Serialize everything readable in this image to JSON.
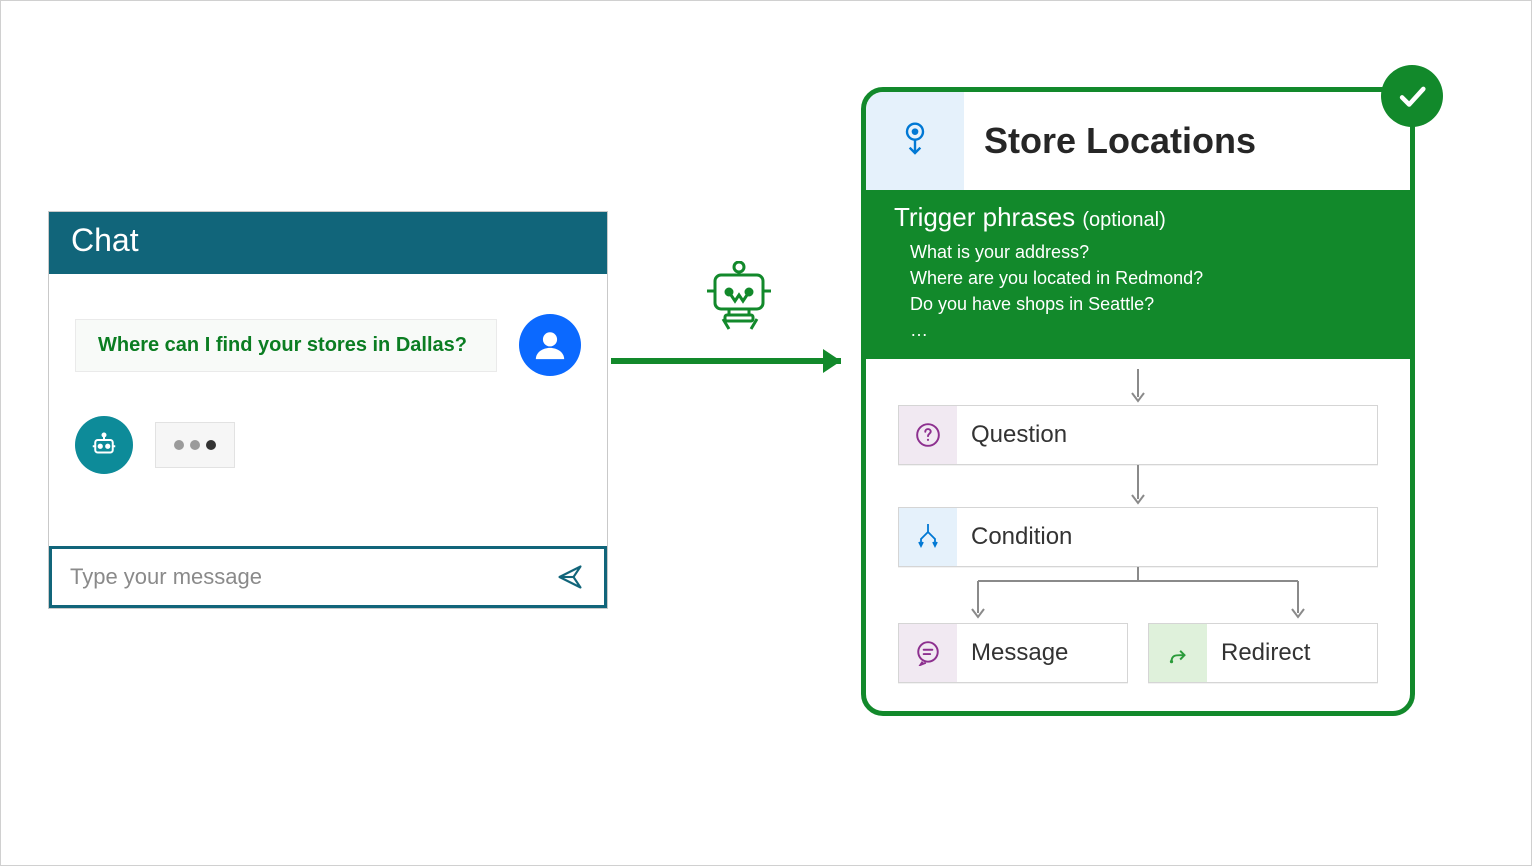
{
  "chat": {
    "title": "Chat",
    "user_message": "Where can I find your stores in Dallas?",
    "input_placeholder": "Type your message"
  },
  "topic": {
    "title": "Store Locations",
    "trigger_title": "Trigger phrases",
    "trigger_note": "(optional)",
    "trigger_phrases": [
      "What is your address?",
      "Where are you located in Redmond?",
      "Do you have shops in Seattle?",
      "…"
    ],
    "nodes": {
      "question": "Question",
      "condition": "Condition",
      "message": "Message",
      "redirect": "Redirect"
    }
  }
}
